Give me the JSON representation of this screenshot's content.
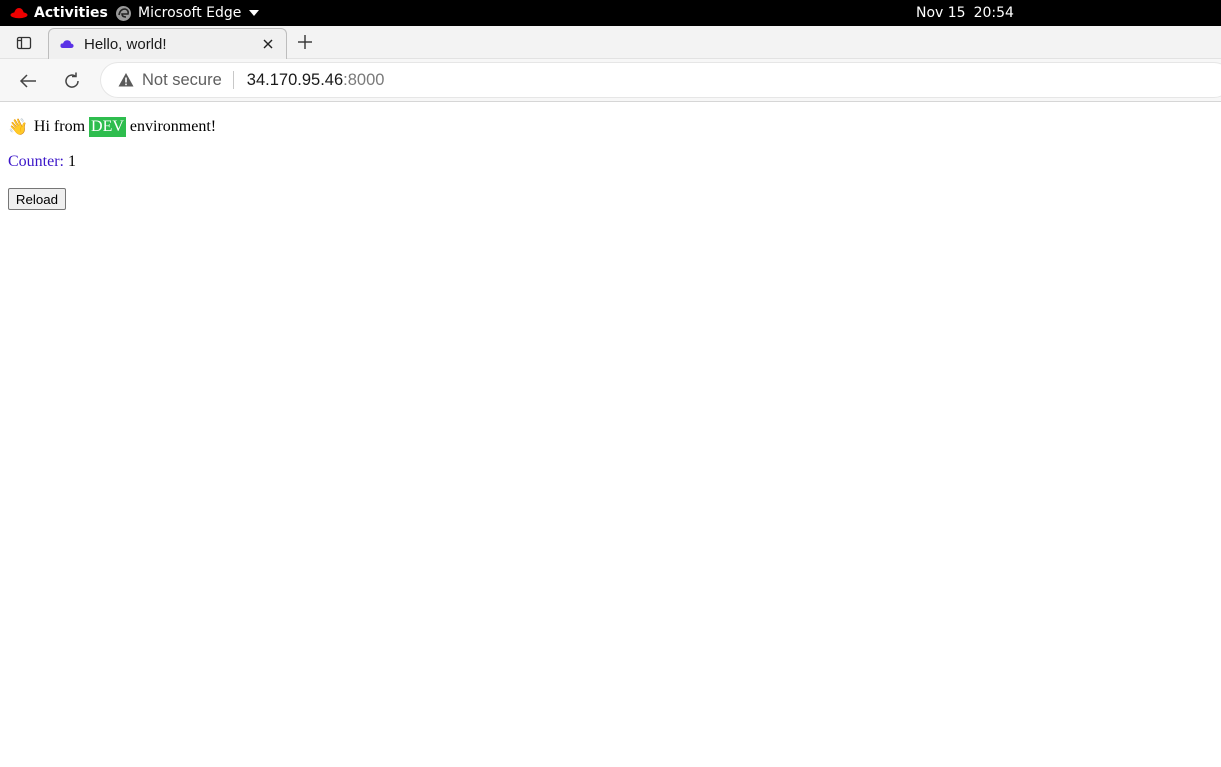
{
  "topbar": {
    "activities_label": "Activities",
    "app_name": "Microsoft Edge",
    "date": "Nov 15",
    "time": "20:54"
  },
  "browser": {
    "tab_title": "Hello, world!",
    "security_label": "Not secure",
    "url_host": "34.170.95.46",
    "url_port": ":8000"
  },
  "page": {
    "wave_emoji": "👋",
    "greeting_prefix": "Hi from",
    "environment": "DEV",
    "greeting_suffix": "environment!",
    "counter_label": "Counter:",
    "counter_value": "1",
    "reload_label": "Reload"
  },
  "colors": {
    "env_badge_bg": "#2ebd4e",
    "counter_label": "#3b16c9",
    "favicon": "#5a32e6"
  },
  "icons": [
    "redhat-icon",
    "edge-icon",
    "caret-down-icon",
    "tab-actions-icon",
    "cloud-favicon-icon",
    "close-icon",
    "plus-icon",
    "back-arrow-icon",
    "refresh-icon",
    "warning-icon"
  ]
}
